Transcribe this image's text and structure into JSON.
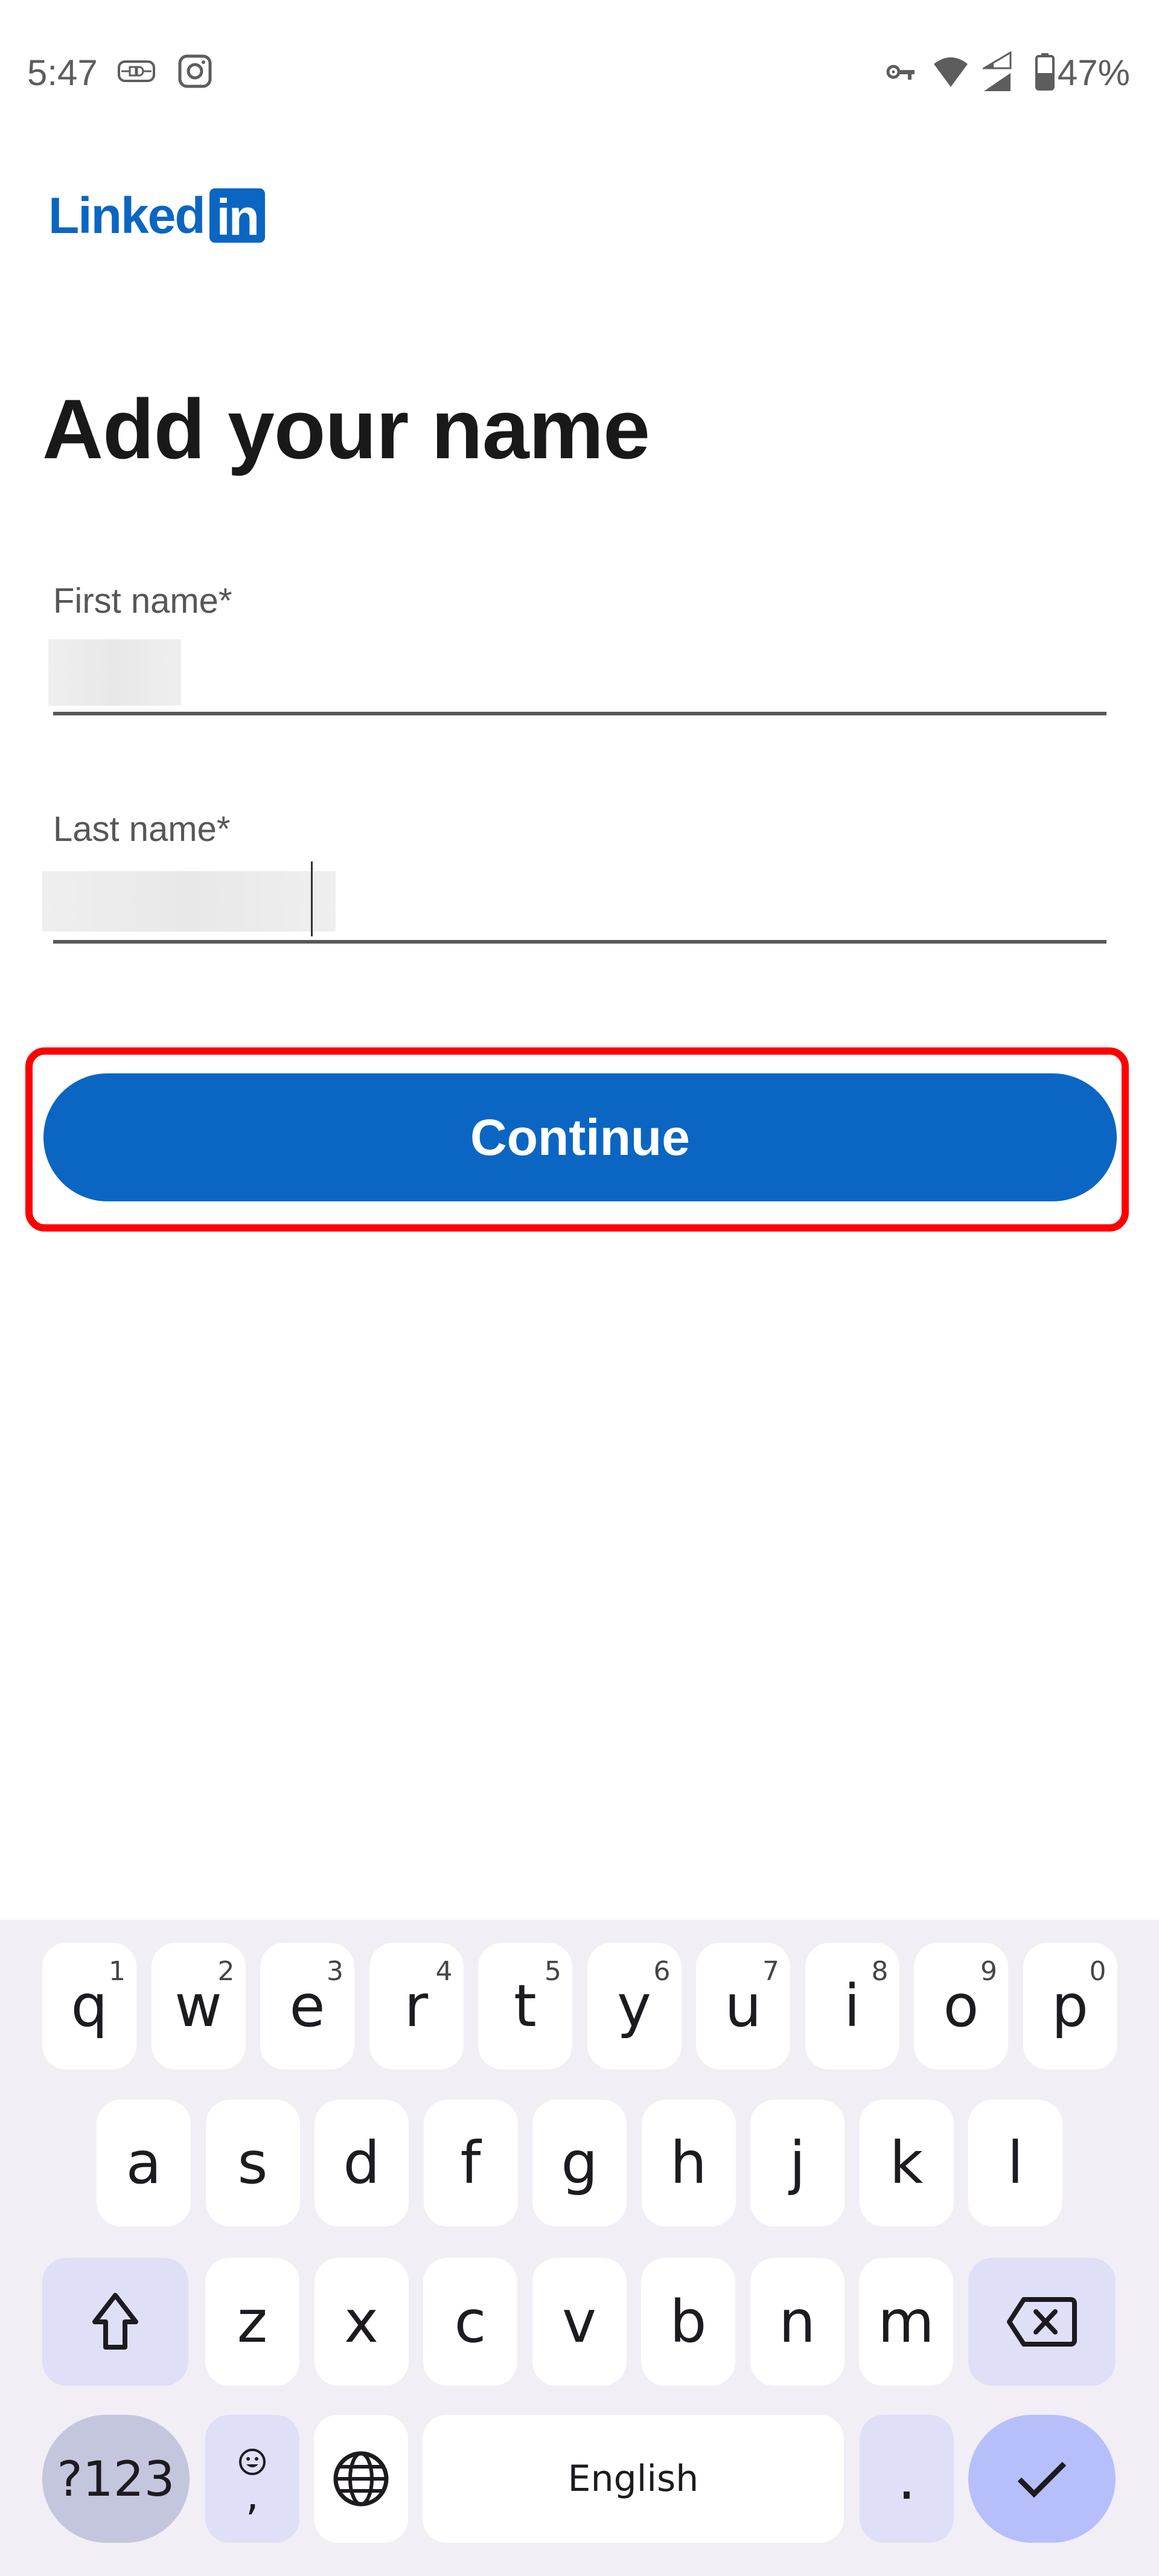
{
  "status_bar": {
    "time": "5:47",
    "left_icons": [
      "usb-debug-icon",
      "instagram-icon"
    ],
    "right_icons": [
      "vpn-key-icon",
      "wifi-icon",
      "cell-signal-icon",
      "battery-icon"
    ],
    "battery_percent": "47%",
    "battery_level": 0.47
  },
  "brand": {
    "word": "Linked",
    "box": "in",
    "color": "#0a66c2"
  },
  "page": {
    "title": "Add your name"
  },
  "form": {
    "first_name": {
      "label": "First name*",
      "value": ""
    },
    "last_name": {
      "label": "Last name*",
      "value": ""
    },
    "continue_label": "Continue",
    "continue_color": "#0a66c2",
    "highlight_color": "#ff0000"
  },
  "keyboard": {
    "row1": [
      {
        "key": "q",
        "hint": "1"
      },
      {
        "key": "w",
        "hint": "2"
      },
      {
        "key": "e",
        "hint": "3"
      },
      {
        "key": "r",
        "hint": "4"
      },
      {
        "key": "t",
        "hint": "5"
      },
      {
        "key": "y",
        "hint": "6"
      },
      {
        "key": "u",
        "hint": "7"
      },
      {
        "key": "i",
        "hint": "8"
      },
      {
        "key": "o",
        "hint": "9"
      },
      {
        "key": "p",
        "hint": "0"
      }
    ],
    "row2": [
      "a",
      "s",
      "d",
      "f",
      "g",
      "h",
      "j",
      "k",
      "l"
    ],
    "row3": [
      "z",
      "x",
      "c",
      "v",
      "b",
      "n",
      "m"
    ],
    "symbols_label": "?123",
    "comma_label": ",",
    "space_label": "English",
    "period_label": "."
  }
}
